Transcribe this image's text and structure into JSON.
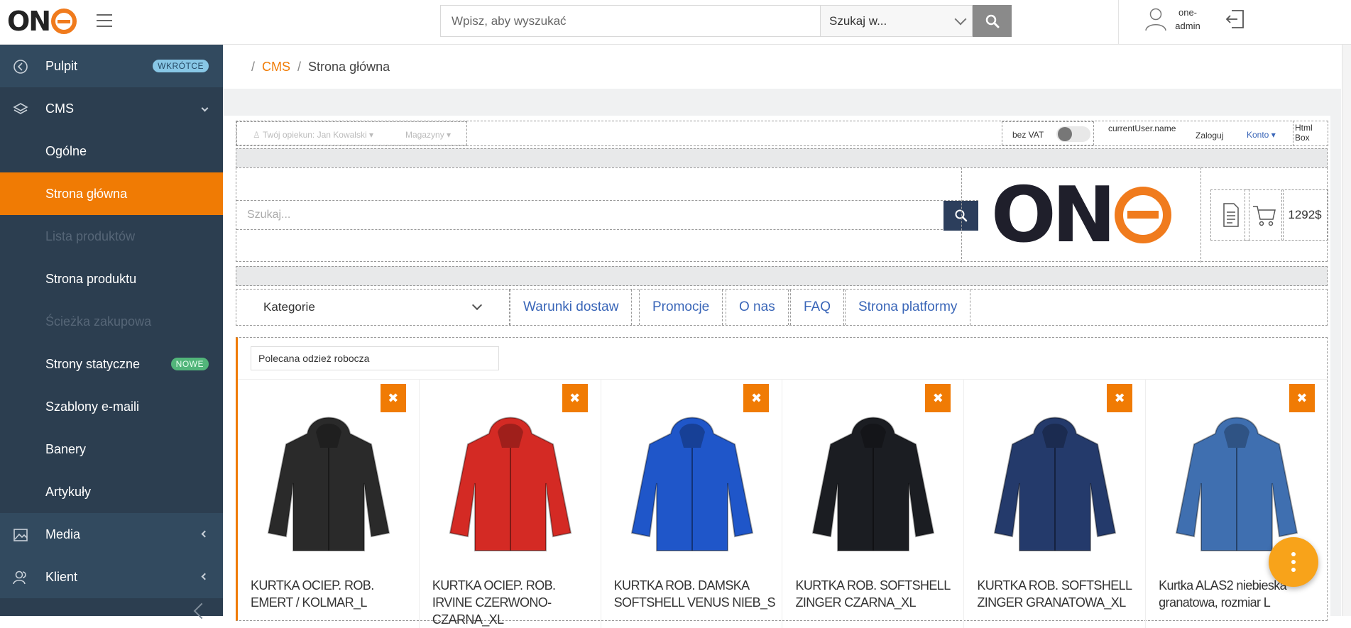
{
  "topbar": {
    "search_placeholder": "Wpisz, aby wyszukać",
    "search_scope": "Szukaj w...",
    "user_name_line1": "one-",
    "user_name_line2": "admin"
  },
  "sidebar": {
    "items": [
      {
        "label": "Pulpit",
        "badge": "WKRÓTCE"
      },
      {
        "label": "CMS"
      },
      {
        "label": "Ogólne"
      },
      {
        "label": "Strona główna"
      },
      {
        "label": "Lista produktów"
      },
      {
        "label": "Strona produktu"
      },
      {
        "label": "Ścieżka zakupowa"
      },
      {
        "label": "Strony statyczne",
        "badge": "NOWE"
      },
      {
        "label": "Szablony e-maili"
      },
      {
        "label": "Banery"
      },
      {
        "label": "Artykuły"
      },
      {
        "label": "Media"
      },
      {
        "label": "Klient"
      }
    ]
  },
  "breadcrumb": {
    "sep": "/",
    "link": "CMS",
    "current": "Strona główna"
  },
  "preview": {
    "top": {
      "guardian": "Twój opiekun: Jan Kowalski",
      "warehouses": "Magazyny",
      "vat_label": "bez VAT",
      "current_user": "currentUser.name",
      "login": "Zaloguj",
      "account": "Konto",
      "html_box": "Html Box"
    },
    "search_placeholder": "Szukaj...",
    "price": "1292$",
    "categories": "Kategorie",
    "nav": [
      "Warunki dostaw",
      "Promocje",
      "O nas",
      "FAQ",
      "Strona platformy"
    ],
    "section_title": "Polecana odzież robocza",
    "products": [
      {
        "name": "KURTKA OCIEP. ROB. EMERT / KOLMAR_L",
        "color": "#2a2a2a"
      },
      {
        "name": "KURTKA OCIEP. ROB. IRVINE CZERWONO-CZARNA_XL",
        "color": "#d42a24"
      },
      {
        "name": "KURTKA ROB. DAMSKA SOFTSHELL VENUS NIEB_S",
        "color": "#1f56c9"
      },
      {
        "name": "KURTKA ROB. SOFTSHELL ZINGER CZARNA_XL",
        "color": "#1b1d22"
      },
      {
        "name": "KURTKA ROB. SOFTSHELL ZINGER GRANATOWA_XL",
        "color": "#243a6b"
      },
      {
        "name": "Kurtka ALAS2 niebieska granatowa, rozmiar L",
        "color": "#3f6fb0"
      }
    ],
    "remove_label": "✖"
  },
  "colors": {
    "accent": "#f07b04",
    "sidebar": "#2c3e50",
    "link": "#3a66b8"
  }
}
